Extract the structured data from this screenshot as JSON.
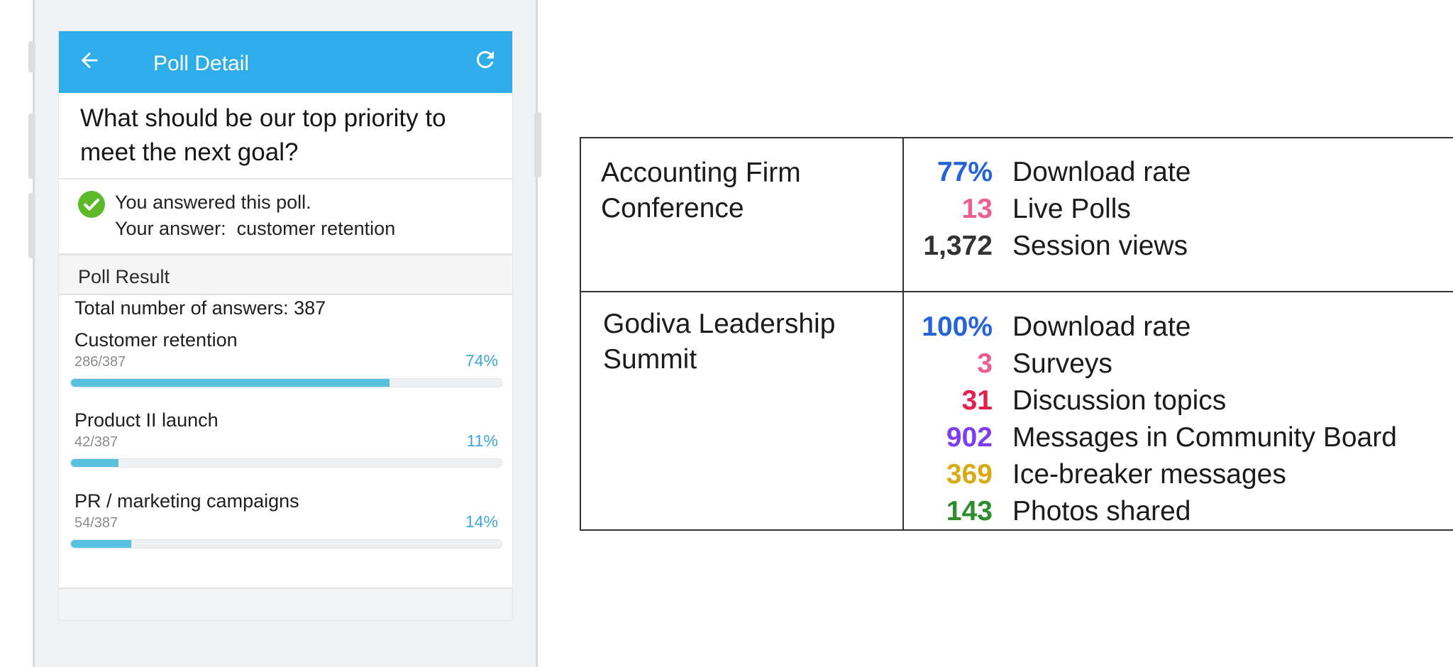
{
  "app_bar": {
    "title": "Poll Detail",
    "back_icon": "arrow-left-icon",
    "refresh_icon": "refresh-icon",
    "color": "#2fadea"
  },
  "poll": {
    "question": "What should be our top priority to meet the next goal?",
    "answered_text": "You answered this poll.",
    "your_answer_text": "Your answer:  customer retention",
    "result_header": "Poll Result",
    "total_text": "Total number of answers: 387",
    "options": [
      {
        "label": "Customer retention",
        "count": "286/387",
        "percent_label": "74%",
        "percent": 74
      },
      {
        "label": "Product II launch",
        "count": "42/387",
        "percent_label": "11%",
        "percent": 11
      },
      {
        "label": "PR / marketing campaigns",
        "count": "54/387",
        "percent_label": "14%",
        "percent": 14
      }
    ]
  },
  "table": {
    "rows": [
      {
        "event": "Accounting Firm Conference",
        "stats": [
          {
            "value": "77%",
            "label": "Download rate",
            "color": "#2563d9"
          },
          {
            "value": "13",
            "label": "Live Polls",
            "color": "#ec5f8d"
          },
          {
            "value": "1,372",
            "label": "Session views",
            "color": "#333333"
          }
        ]
      },
      {
        "event": "Godiva Leadership Summit",
        "stats": [
          {
            "value": "100%",
            "label": "Download rate",
            "color": "#2563d9"
          },
          {
            "value": "3",
            "label": "Surveys",
            "color": "#ec5f8d"
          },
          {
            "value": "31",
            "label": "Discussion topics",
            "color": "#e3204f"
          },
          {
            "value": "902",
            "label": "Messages in Community Board",
            "color": "#7c3ef0"
          },
          {
            "value": "369",
            "label": "Ice-breaker messages",
            "color": "#d8ab14"
          },
          {
            "value": "143",
            "label": "Photos shared",
            "color": "#2d8d2d"
          }
        ]
      }
    ]
  }
}
